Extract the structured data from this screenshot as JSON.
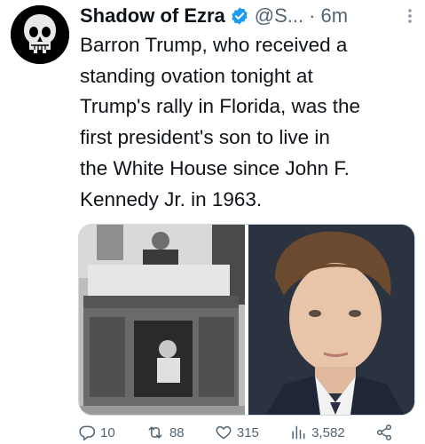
{
  "tweet": {
    "display_name": "Shadow of Ezra",
    "handle": "@S...",
    "separator": "·",
    "time": "6m",
    "text": "Barron Trump, who received a\nstanding ovation tonight at\nTrump's rally in Florida, was the\nfirst president's son to live in\nthe White House since John F.\nKennedy Jr. in 1963."
  },
  "actions": {
    "replies": "10",
    "retweets": "88",
    "likes": "315",
    "views": "3,582"
  },
  "icons": {
    "avatar": "punisher-skull-avatar",
    "verified": "verified-badge-icon",
    "more": "more-options-icon",
    "reply": "reply-icon",
    "retweet": "retweet-icon",
    "like": "heart-icon",
    "views": "views-chart-icon",
    "share": "share-icon"
  },
  "colors": {
    "text": "#0f1419",
    "secondary": "#536471",
    "verified_blue": "#1d9bf0",
    "background": "#ffffff"
  }
}
